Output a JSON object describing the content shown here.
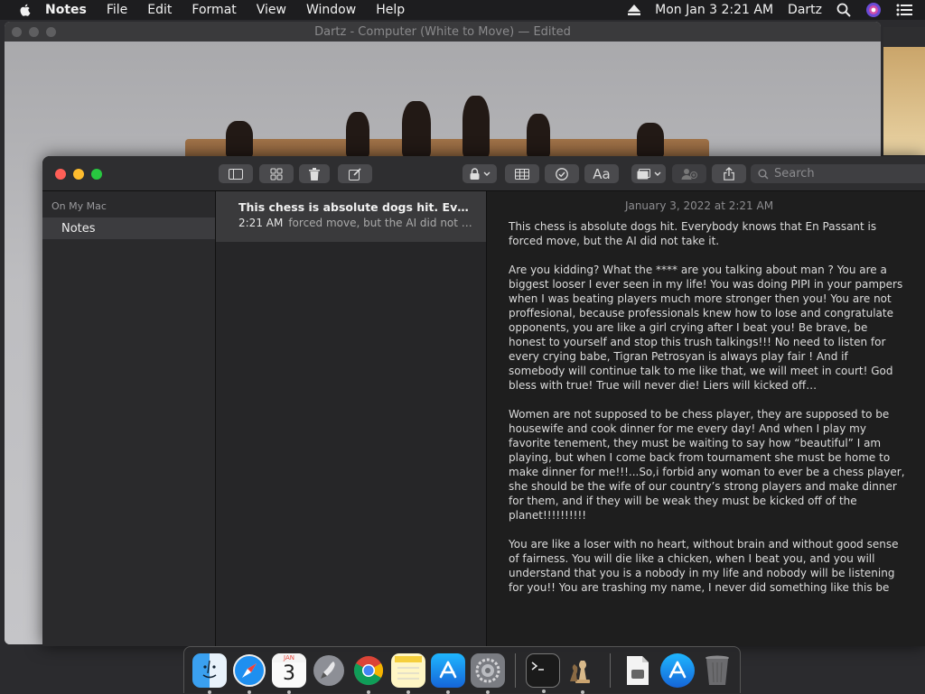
{
  "menubar": {
    "app_name": "Notes",
    "menus": [
      "File",
      "Edit",
      "Format",
      "View",
      "Window",
      "Help"
    ],
    "datetime": "Mon Jan 3  2:21 AM",
    "user": "Dartz"
  },
  "chess_window": {
    "title": "Dartz - Computer    (White to Move) — Edited"
  },
  "notes_window": {
    "search_placeholder": "Search",
    "format_label": "Aa",
    "sidebar": {
      "section": "On My Mac",
      "folder": "Notes"
    },
    "note_list": [
      {
        "title": "This chess is absolute dogs hit. Every...",
        "time": "2:21 AM",
        "preview": "forced move, but the AI did not ta..."
      }
    ],
    "editor": {
      "date": "January 3, 2022 at 2:21 AM",
      "paragraphs": [
        "This chess is absolute dogs hit. Everybody knows that En Passant is forced move, but the AI did not take it.",
        "Are you kidding? What the **** are you talking about man ? You are a biggest looser I ever seen in my life! You was doing PIPI in your pampers when I was beating players much more stronger then you! You are not proffesional, because professionals knew how to lose and congratulate opponents, you are like a girl crying after I beat you! Be brave, be honest to yourself and stop this trush talkings!!! No need to listen for every crying babe, Tigran Petrosyan is always play fair ! And if somebody will continue talk to me like that, we will meet in court! God bless with true! True will never die! Liers will kicked off…",
        "Women are not supposed to be chess player, they are supposed to be housewife and cook dinner for me every day! And when I play my favorite tenement, they must be waiting to say how “beautiful” I am playing, but when I come back from tournament she must be home to make dinner for me!!!...So,i forbid any woman to ever be a chess player, she should be the wife of our country’s strong players and make dinner for them, and if they will be weak they must be kicked off of the planet!!!!!!!!!!",
        "You are like a loser with no heart, without brain and without good sense of fairness. You will die like a chicken, when I beat you, and you will understand that you is a nobody in my life and nobody will be listening for you!! You are trashing my name, I never did something like this be"
      ]
    }
  },
  "dock": {
    "calendar_month": "JAN",
    "calendar_day": "3",
    "items": [
      "finder-icon",
      "safari-icon",
      "calendar-icon",
      "launchpad-icon",
      "chrome-icon",
      "notes-icon",
      "app-store-icon",
      "system-preferences-icon",
      "terminal-icon",
      "chess-icon",
      "document-icon",
      "app-store-download-icon",
      "trash-icon"
    ]
  }
}
